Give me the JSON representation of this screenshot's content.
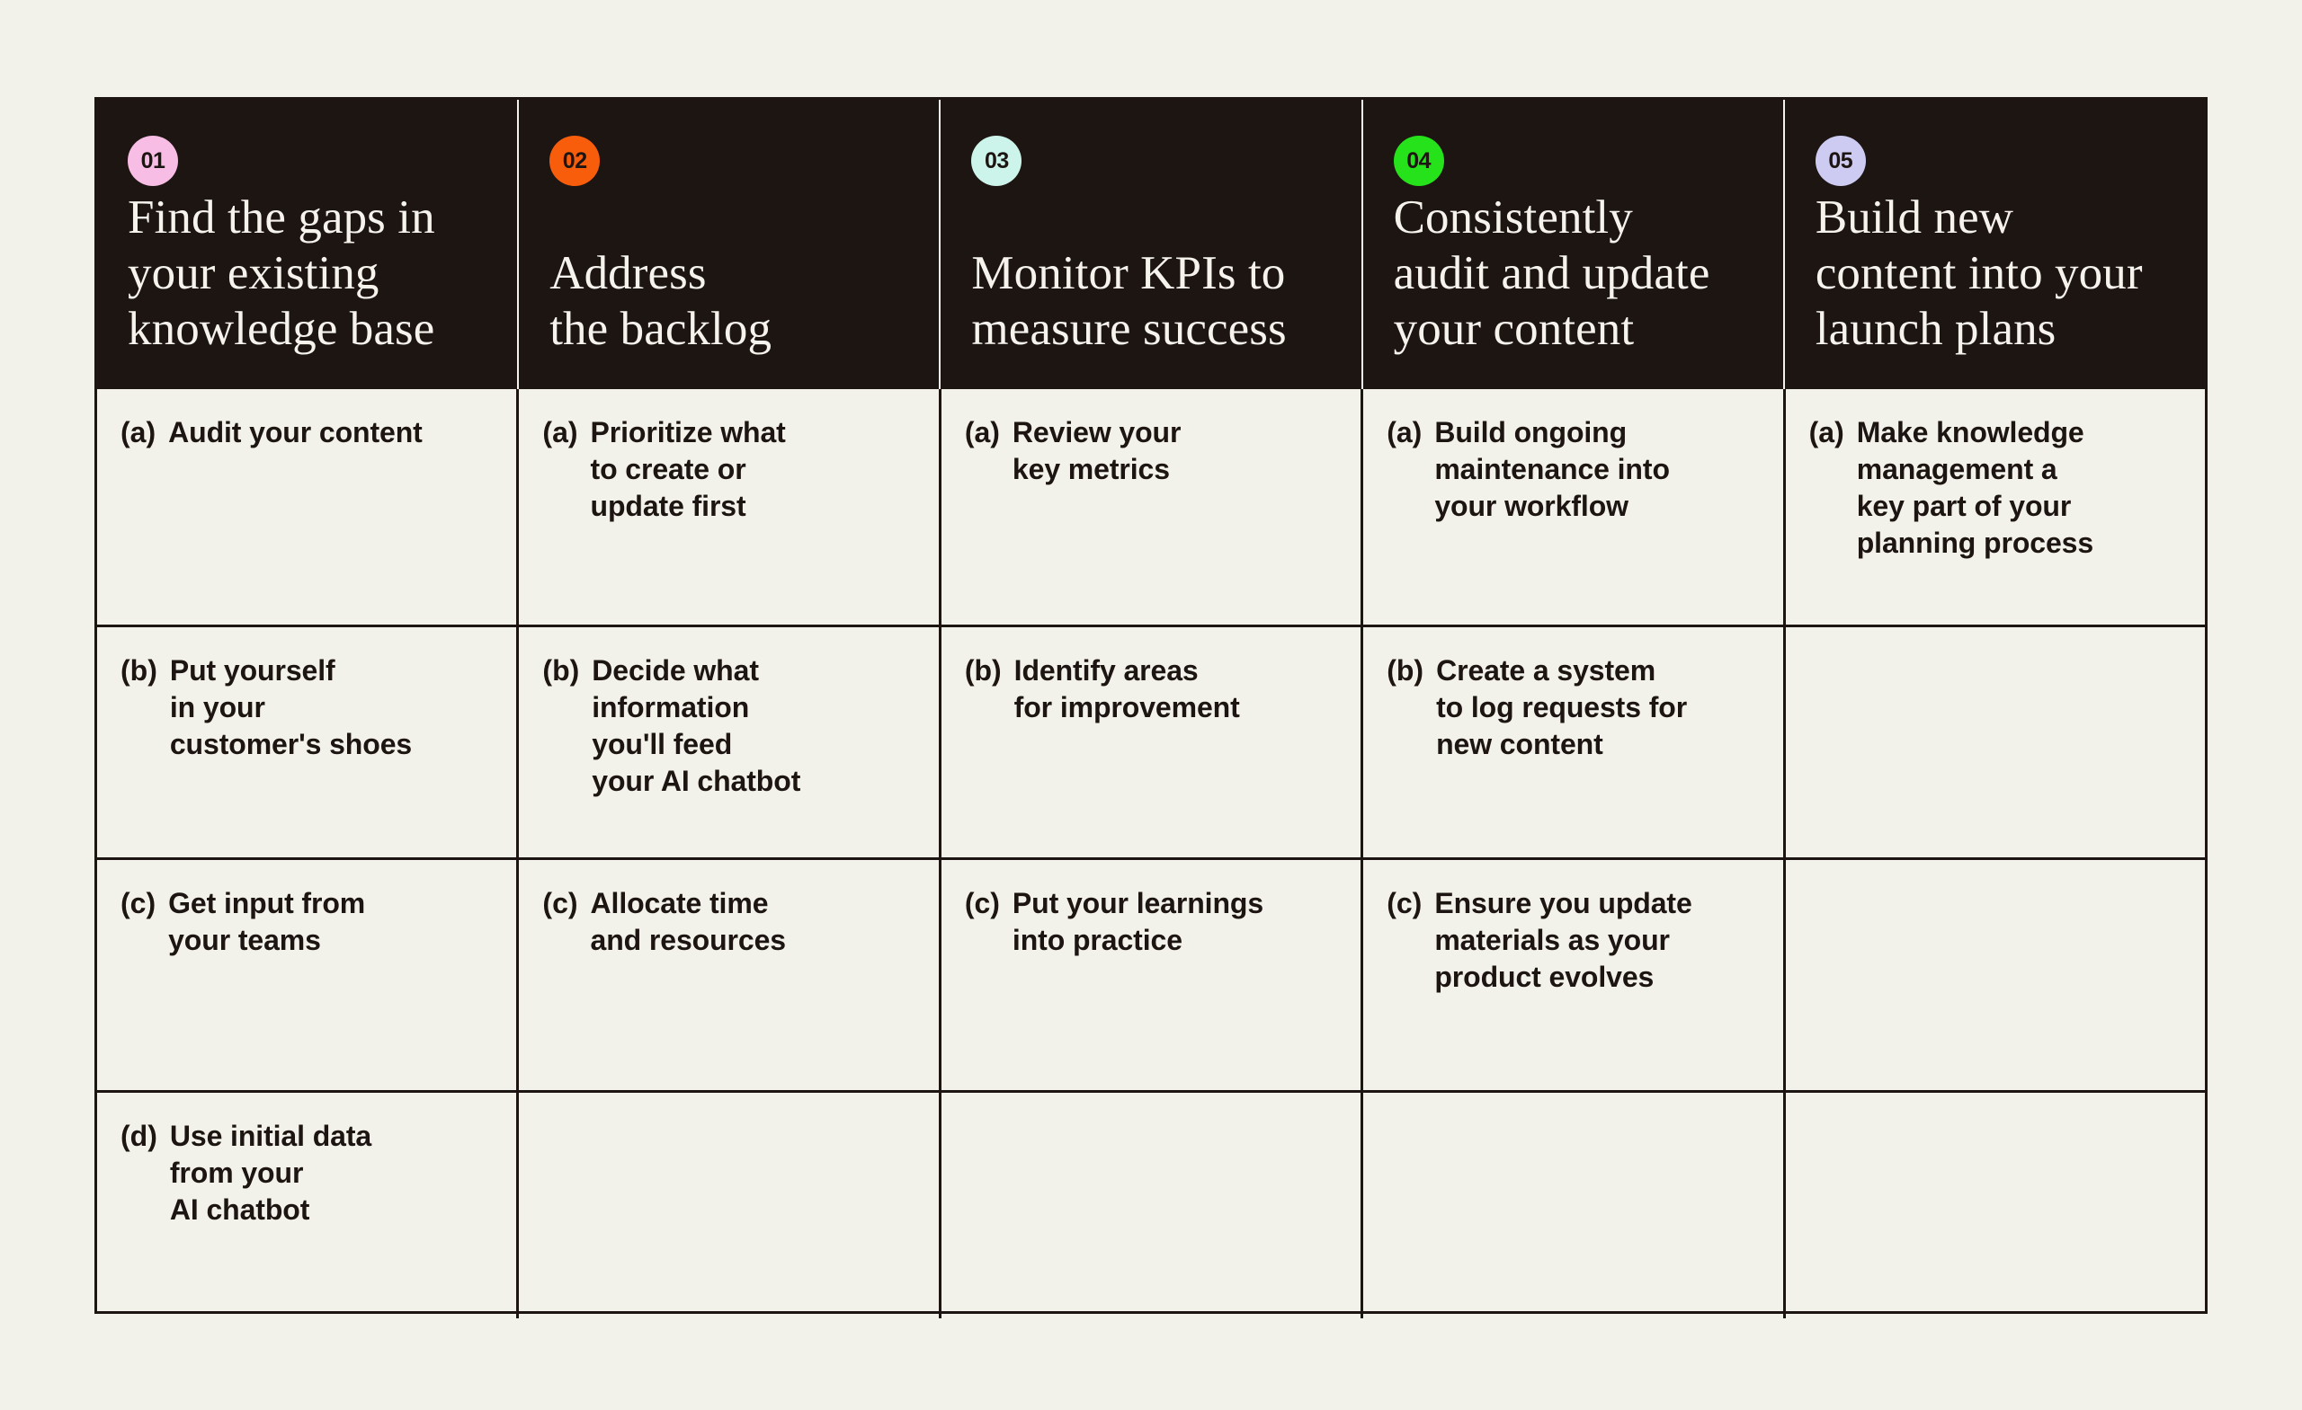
{
  "canvas": {
    "background_color": "#f3f2ea",
    "panel_color": "#1d1512",
    "rule_color": "#1d1512"
  },
  "columns": [
    {
      "number": "01",
      "badge_color": "#f7bde4",
      "title": "Find the gaps in\nyour existing\nknowledge base",
      "items": [
        {
          "marker": "(a)",
          "text": "Audit your content"
        },
        {
          "marker": "(b)",
          "text": "Put yourself\nin your\ncustomer's shoes"
        },
        {
          "marker": "(c)",
          "text": "Get input from\nyour teams"
        },
        {
          "marker": "(d)",
          "text": "Use initial data\nfrom your\nAI chatbot"
        }
      ]
    },
    {
      "number": "02",
      "badge_color": "#f85d0c",
      "title": "Address\nthe backlog",
      "items": [
        {
          "marker": "(a)",
          "text": "Prioritize what\nto create or\nupdate first"
        },
        {
          "marker": "(b)",
          "text": "Decide what\ninformation\nyou'll feed\nyour AI chatbot"
        },
        {
          "marker": "(c)",
          "text": "Allocate time\nand resources"
        },
        {
          "marker": "",
          "text": ""
        }
      ]
    },
    {
      "number": "03",
      "badge_color": "#cdf4ea",
      "title": "Monitor KPIs to\nmeasure success",
      "items": [
        {
          "marker": "(a)",
          "text": "Review your\nkey metrics"
        },
        {
          "marker": "(b)",
          "text": "Identify areas\nfor improvement"
        },
        {
          "marker": "(c)",
          "text": "Put your learnings\ninto practice"
        },
        {
          "marker": "",
          "text": ""
        }
      ]
    },
    {
      "number": "04",
      "badge_color": "#25e21a",
      "title": "Consistently\naudit and update\nyour content",
      "items": [
        {
          "marker": "(a)",
          "text": "Build ongoing\nmaintenance into\nyour workflow"
        },
        {
          "marker": "(b)",
          "text": "Create a system\nto log requests for\nnew content"
        },
        {
          "marker": "(c)",
          "text": "Ensure you update\nmaterials as your\nproduct evolves"
        },
        {
          "marker": "",
          "text": ""
        }
      ]
    },
    {
      "number": "05",
      "badge_color": "#cdcbf2",
      "title": "Build new\ncontent into your\nlaunch plans",
      "items": [
        {
          "marker": "(a)",
          "text": "Make knowledge\nmanagement a\nkey part of your\nplanning process"
        },
        {
          "marker": "",
          "text": ""
        },
        {
          "marker": "",
          "text": ""
        },
        {
          "marker": "",
          "text": ""
        }
      ]
    }
  ]
}
